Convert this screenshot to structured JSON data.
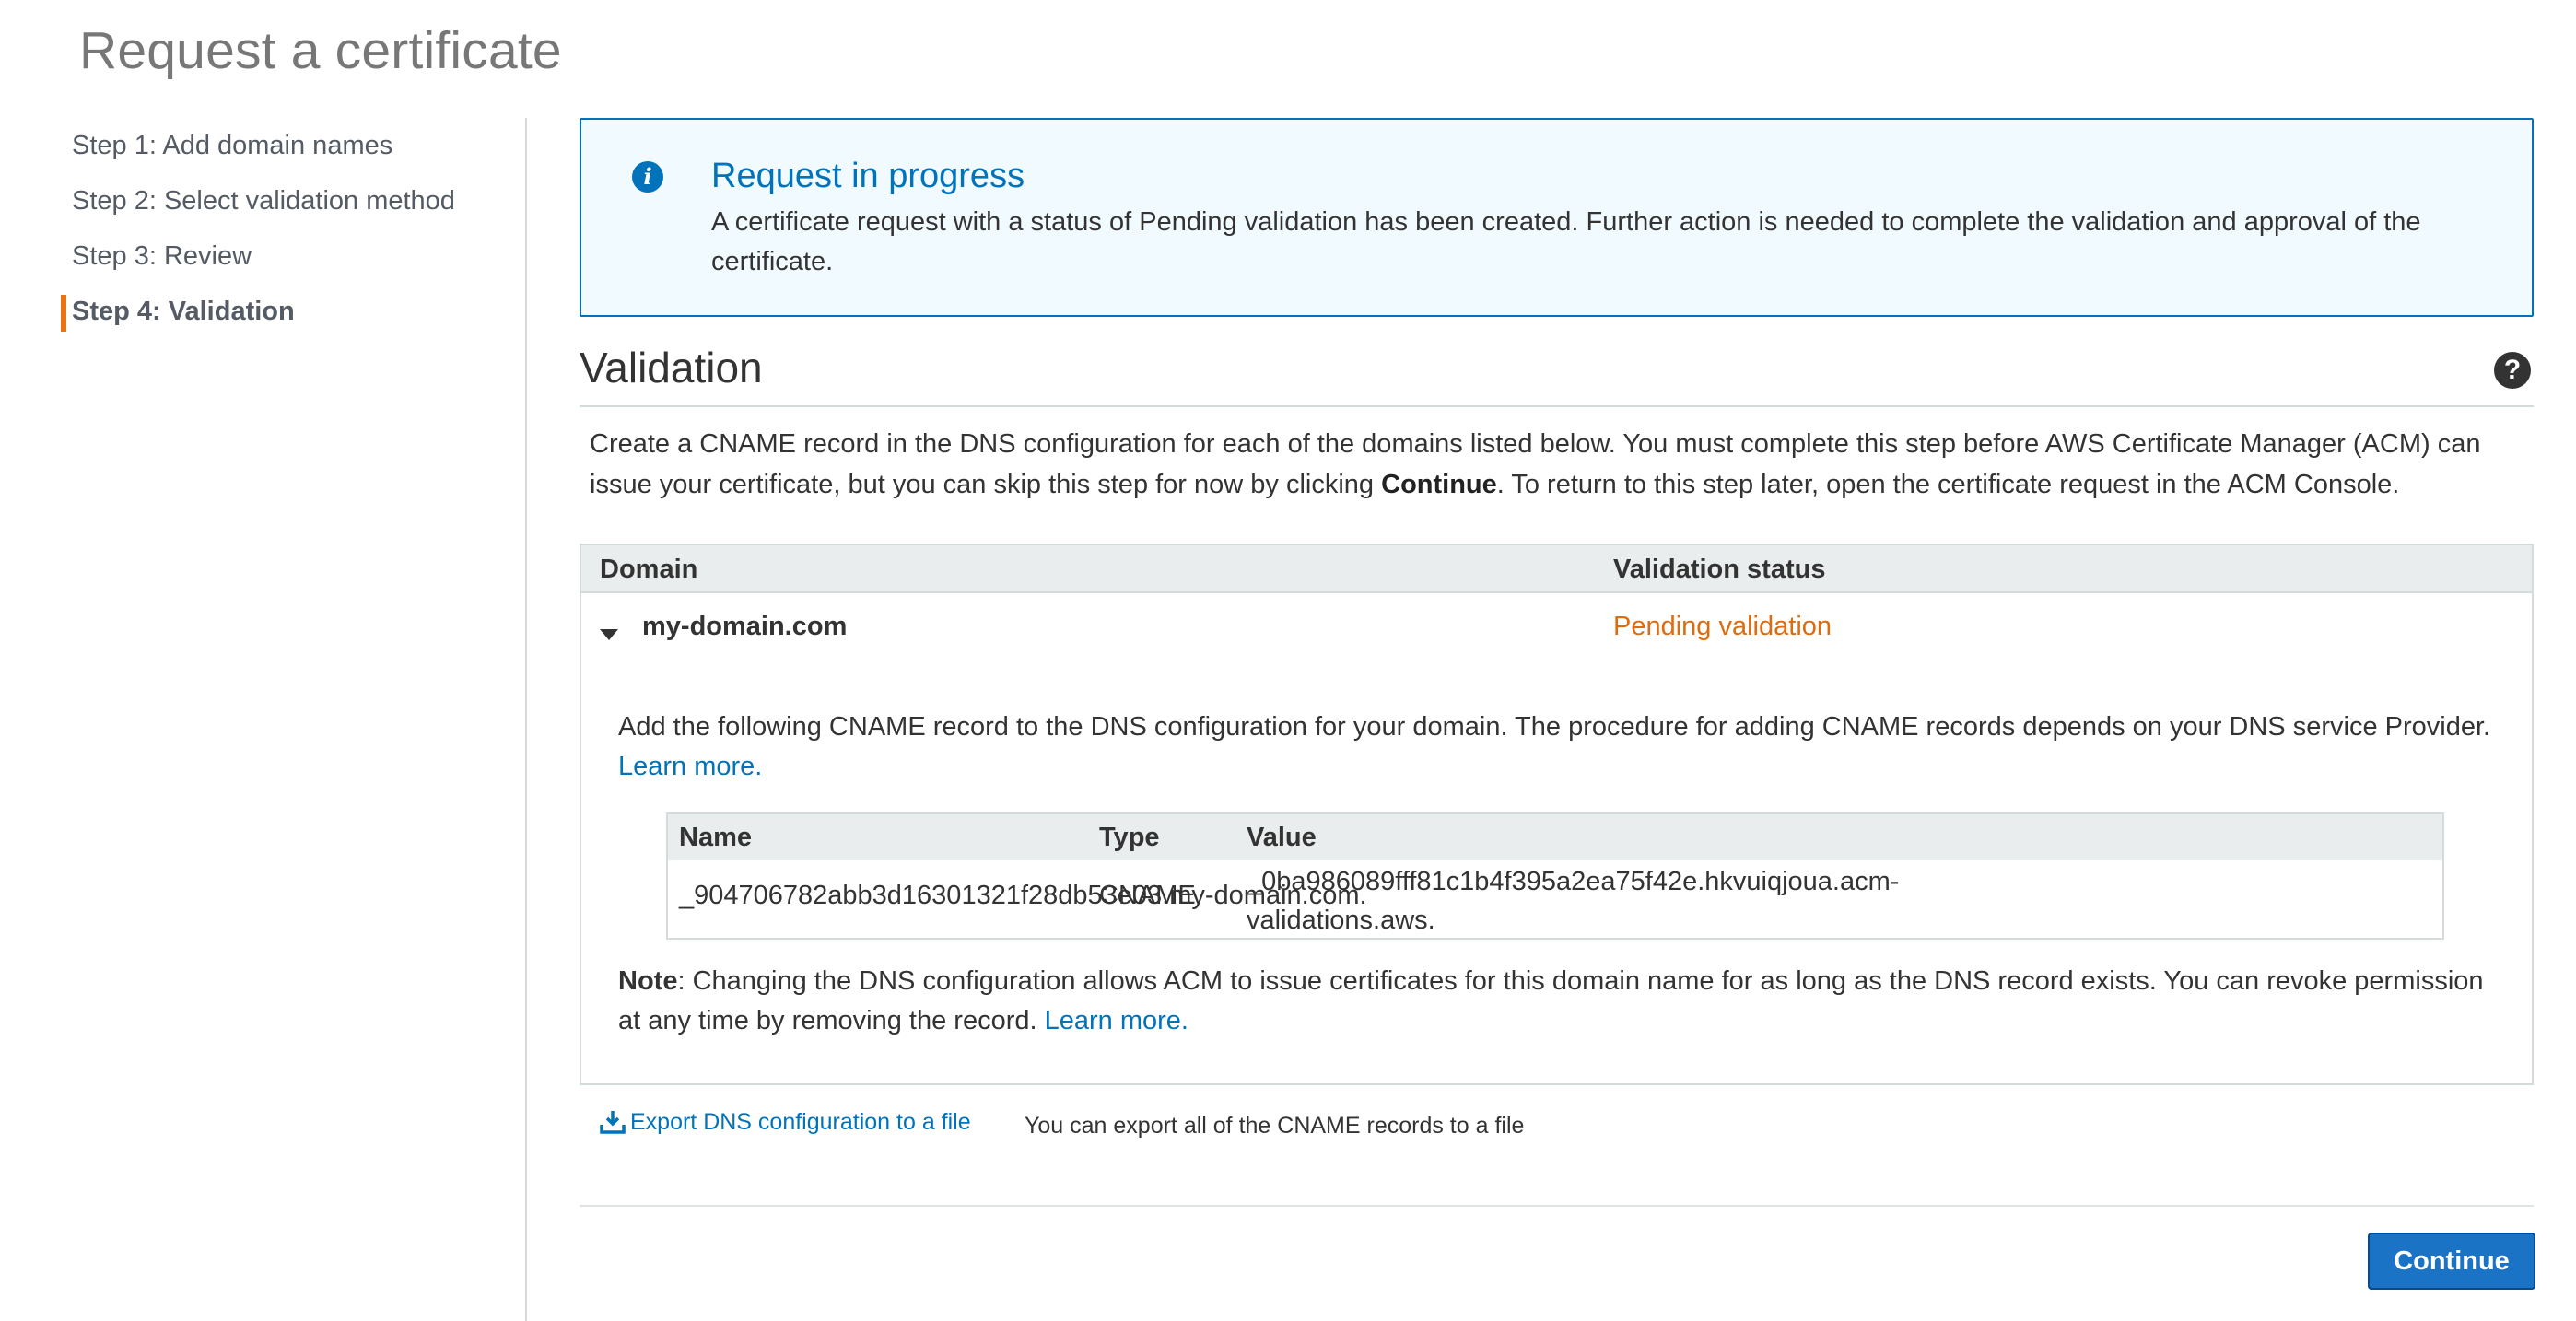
{
  "page_title": "Request a certificate",
  "steps": [
    {
      "label": "Step 1: Add domain names",
      "active": false
    },
    {
      "label": "Step 2: Select validation method",
      "active": false
    },
    {
      "label": "Step 3: Review",
      "active": false
    },
    {
      "label": "Step 4: Validation",
      "active": true
    }
  ],
  "info": {
    "icon": "info-icon",
    "title": "Request in progress",
    "text": "A certificate request with a status of Pending validation has been created. Further action is needed to complete the validation and approval of the certificate."
  },
  "validation": {
    "title": "Validation",
    "help_icon": "help-icon",
    "desc_before": "Create a CNAME record in the DNS configuration for each of the domains listed below. You must complete this step before AWS Certificate Manager (ACM) can issue your certificate, but you can skip this step for now by clicking ",
    "desc_bold": "Continue",
    "desc_after": ". To return to this step later, open the certificate request in the ACM Console."
  },
  "domain_table": {
    "headers": {
      "domain": "Domain",
      "status": "Validation status"
    },
    "row": {
      "domain": "my-domain.com",
      "status": "Pending validation",
      "status_color": "#dd6b10",
      "cname_desc": "Add the following CNAME record to the DNS configuration for your domain. The procedure for adding CNAME records depends on your DNS service Provider.",
      "learn_more": "Learn more.",
      "record_headers": {
        "name": "Name",
        "type": "Type",
        "value": "Value"
      },
      "record": {
        "name": "_904706782abb3d16301321f28db53e03.my-domain.com.",
        "type": "CNAME",
        "value_line1": "_0ba986089fff81c1b4f395a2ea75f42e.hkvuiqjoua.acm-",
        "value_line2": "validations.aws."
      },
      "note_label": "Note",
      "note_text": ": Changing the DNS configuration allows ACM to issue certificates for this domain name for as long as the DNS record exists. You can revoke permission at any time by removing the record. ",
      "note_link": "Learn more."
    }
  },
  "export": {
    "icon": "download-icon",
    "link": "Export DNS configuration to a file",
    "hint": "You can export all of the CNAME records to a file"
  },
  "continue_label": "Continue",
  "colors": {
    "accent": "#0073bb",
    "active_step": "#ec7211",
    "button": "#1a73c5"
  }
}
